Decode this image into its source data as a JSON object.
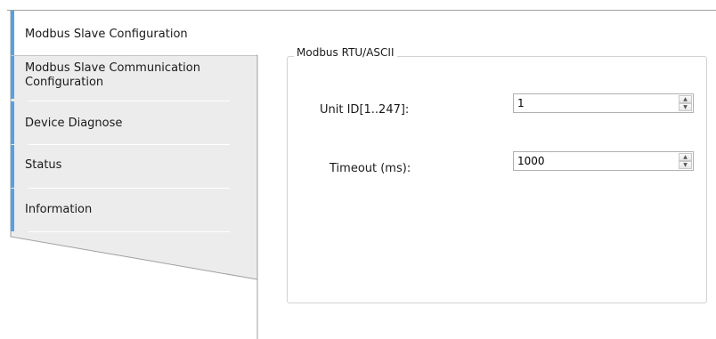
{
  "nav": {
    "items": [
      {
        "label": "Modbus Slave Configuration",
        "active": true
      },
      {
        "label": "Modbus Slave Communication Configuration",
        "active": false
      },
      {
        "label": "Device Diagnose",
        "active": false
      },
      {
        "label": "Status",
        "active": false
      },
      {
        "label": "Information",
        "active": false
      }
    ]
  },
  "group": {
    "title": "Modbus RTU/ASCII",
    "fields": [
      {
        "label": "Unit ID[1..247]:",
        "value": "1"
      },
      {
        "label": "Timeout (ms):",
        "value": "1000"
      }
    ]
  },
  "colors": {
    "accent": "#56a1e3",
    "nav_background": "#ececec",
    "border": "#a0a0a0"
  },
  "icons": {
    "spin_up": "spin-up-arrow-icon",
    "spin_down": "spin-down-arrow-icon"
  }
}
